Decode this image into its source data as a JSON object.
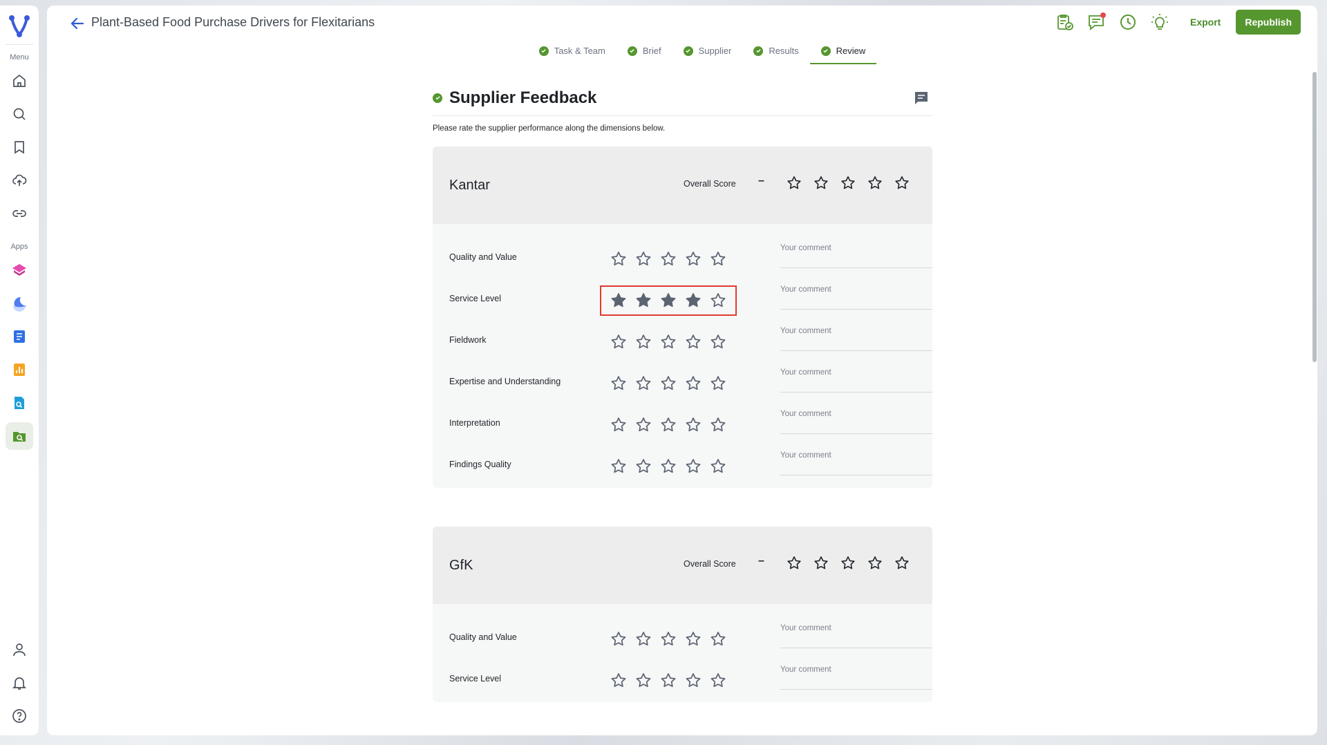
{
  "sidebar": {
    "menu_label": "Menu",
    "apps_label": "Apps",
    "menu_icons": [
      "home-icon",
      "search-icon",
      "bookmark-icon",
      "upload-cloud-icon",
      "link-icon"
    ],
    "app_icons": [
      "layers-app-icon",
      "moon-app-icon",
      "document-app-icon",
      "chart-app-icon",
      "file-search-app-icon",
      "folder-search-app-icon"
    ],
    "bottom_icons": [
      "user-icon",
      "bell-icon",
      "help-icon"
    ]
  },
  "header": {
    "title": "Plant-Based Food Purchase Drivers for Flexitarians",
    "export_label": "Export",
    "republish_label": "Republish"
  },
  "steps": [
    {
      "label": "Task & Team"
    },
    {
      "label": "Brief"
    },
    {
      "label": "Supplier"
    },
    {
      "label": "Results"
    },
    {
      "label": "Review"
    }
  ],
  "section": {
    "title": "Supplier Feedback",
    "intro": "Please rate the supplier performance along the dimensions below."
  },
  "overall_label": "Overall Score",
  "overall_dash": "–",
  "comment_placeholder": "Your comment",
  "suppliers": [
    {
      "name": "Kantar",
      "dimensions": [
        {
          "label": "Quality and Value",
          "rating": 0
        },
        {
          "label": "Service Level",
          "rating": 4
        },
        {
          "label": "Fieldwork",
          "rating": 0
        },
        {
          "label": "Expertise and Understanding",
          "rating": 0
        },
        {
          "label": "Interpretation",
          "rating": 0
        },
        {
          "label": "Findings Quality",
          "rating": 0
        }
      ]
    },
    {
      "name": "GfK",
      "dimensions": [
        {
          "label": "Quality and Value",
          "rating": 0
        },
        {
          "label": "Service Level",
          "rating": 0
        }
      ]
    }
  ],
  "colors": {
    "accent": "#56962f",
    "star": "#5b6471",
    "highlight": "#e03a2f"
  }
}
